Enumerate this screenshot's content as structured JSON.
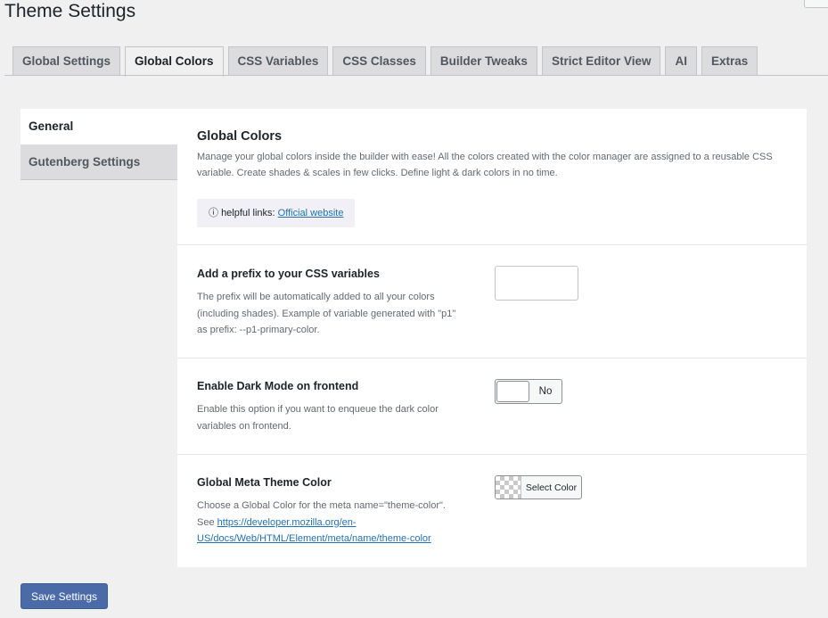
{
  "page": {
    "title": "Theme Settings"
  },
  "tabs": [
    {
      "label": "Global Settings",
      "active": false
    },
    {
      "label": "Global Colors",
      "active": true
    },
    {
      "label": "CSS Variables",
      "active": false
    },
    {
      "label": "CSS Classes",
      "active": false
    },
    {
      "label": "Builder Tweaks",
      "active": false
    },
    {
      "label": "Strict Editor View",
      "active": false
    },
    {
      "label": "AI",
      "active": false
    },
    {
      "label": "Extras",
      "active": false
    }
  ],
  "sidebar": {
    "items": [
      {
        "label": "General",
        "active": true
      },
      {
        "label": "Gutenberg Settings",
        "active": false
      }
    ]
  },
  "intro": {
    "title": "Global Colors",
    "description": "Manage your global colors inside the builder with ease! All the colors created with the color manager are assigned to a reusable CSS variable. Create shades & scales in few clicks. Define light & dark colors in no time.",
    "help_icon": "ⓘ",
    "help_prefix": "helpful links:",
    "help_link": "Official website"
  },
  "settings": {
    "prefix": {
      "title": "Add a prefix to your CSS variables",
      "description": "The prefix will be automatically added to all your colors (including shades). Example of variable generated with \"p1\" as prefix: --p1-primary-color.",
      "value": ""
    },
    "dark_mode": {
      "title": "Enable Dark Mode on frontend",
      "description": "Enable this option if you want to enqueue the dark color variables on frontend.",
      "toggle_label": "No"
    },
    "meta_color": {
      "title": "Global Meta Theme Color",
      "description": "Choose a Global Color for the meta name=\"theme-color\". See",
      "link": "https://developer.mozilla.org/en-US/docs/Web/HTML/Element/meta/name/theme-color",
      "button_label": "Select Color"
    }
  },
  "footer": {
    "save_label": "Save Settings"
  },
  "colors": {
    "accent": "#4b6ba8",
    "link": "#2271b1",
    "background": "#f0f0f1"
  }
}
